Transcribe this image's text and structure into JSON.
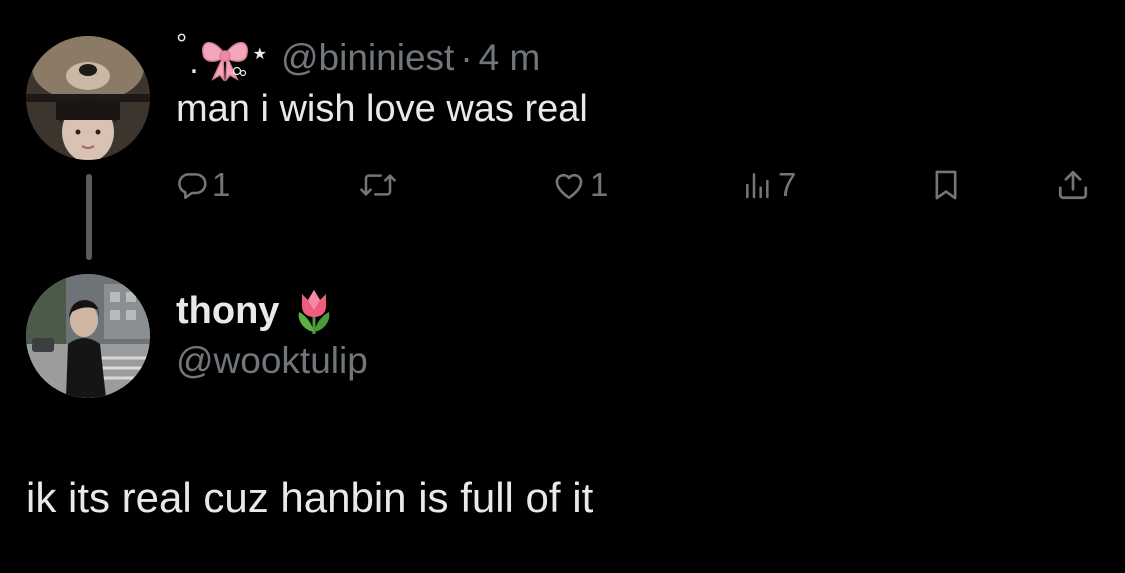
{
  "parent_tweet": {
    "author": {
      "decoration_icons": [
        "ring-dot-icon",
        "bow-icon",
        "star-icon"
      ],
      "handle": "@bininiest",
      "separator": "·",
      "timestamp": "4 m"
    },
    "text": "man i wish love was real",
    "actions": {
      "replies": {
        "icon": "reply-icon",
        "count": "1"
      },
      "retweets": {
        "icon": "retweet-icon"
      },
      "likes": {
        "icon": "heart-icon",
        "count": "1"
      },
      "views": {
        "icon": "views-icon",
        "count": "7"
      },
      "bookmark": {
        "icon": "bookmark-icon"
      },
      "share": {
        "icon": "share-icon"
      }
    }
  },
  "reply_tweet": {
    "author": {
      "display_name": "thony",
      "emoji_icon": "tulip-icon",
      "handle": "@wooktulip"
    },
    "text": "ik its real cuz hanbin is full of it"
  },
  "colors": {
    "background": "#000000",
    "primary_text": "#e7e9ea",
    "secondary_text": "#71767b",
    "thread_line": "#5a5d60",
    "bow_pink": "#f4a7b9",
    "tulip_pink": "#ee5c7e",
    "tulip_green": "#4c9a3a"
  }
}
